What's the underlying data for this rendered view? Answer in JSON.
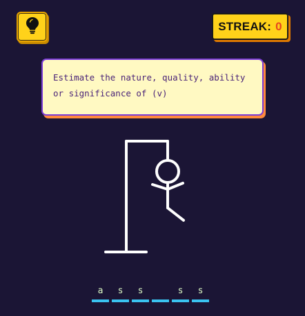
{
  "hint_button": {
    "icon": "lightbulb-icon"
  },
  "streak": {
    "label": "STREAK:",
    "count": "0"
  },
  "clue": {
    "text": "Estimate the nature, quality, ability or significance of (v)"
  },
  "word": {
    "slots": [
      "a",
      "s",
      "s",
      "",
      "s",
      "s"
    ]
  },
  "colors": {
    "background": "#1b1535",
    "accent_yellow": "#ffd21a",
    "slot_line": "#3ac3f0",
    "clue_text": "#4a2378"
  }
}
